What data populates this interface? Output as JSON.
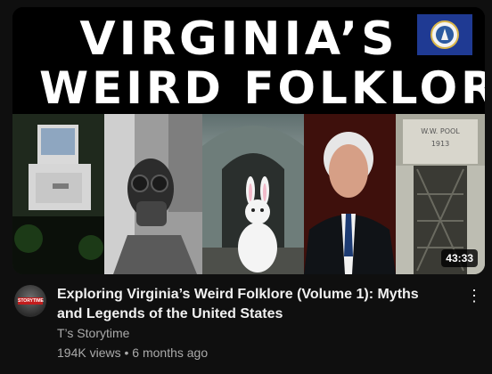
{
  "thumbnail": {
    "title_line1": "VIRGINIA’S",
    "title_line2": "WEIRD FOLKLORE",
    "duration": "43:33",
    "flag_icon": "virginia-flag-icon",
    "monument_text": "W.W. POOL 1913"
  },
  "video": {
    "title": "Exploring Virginia’s Weird Folklore (Volume 1): Myths and Legends of the United States",
    "channel": "T’s Storytime",
    "views": "194K views",
    "age": "6 months ago",
    "separator": "•"
  },
  "avatar": {
    "label": "STORYTIME"
  },
  "menu": {
    "icon": "more-vertical-icon",
    "glyph": "⋮"
  }
}
